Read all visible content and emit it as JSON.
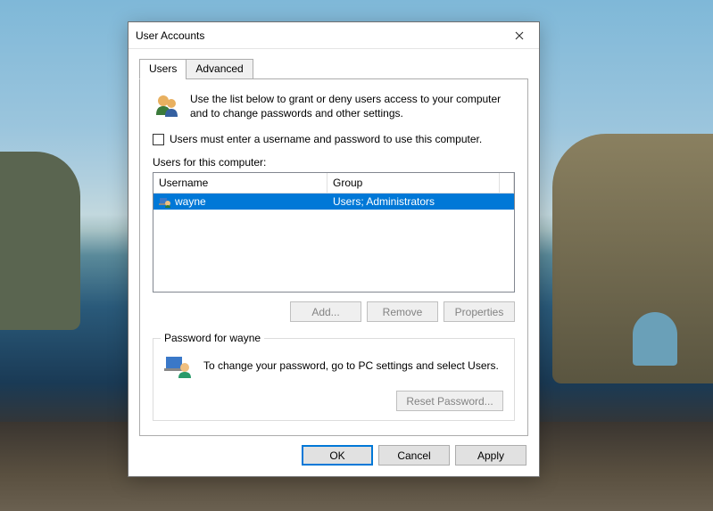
{
  "window": {
    "title": "User Accounts"
  },
  "tabs": {
    "users": "Users",
    "advanced": "Advanced"
  },
  "intro_text": "Use the list below to grant or deny users access to your computer and to change passwords and other settings.",
  "checkbox_label": "Users must enter a username and password to use this computer.",
  "users_label": "Users for this computer:",
  "columns": {
    "username": "Username",
    "group": "Group"
  },
  "rows": [
    {
      "username": "wayne",
      "group": "Users; Administrators"
    }
  ],
  "buttons": {
    "add": "Add...",
    "remove": "Remove",
    "properties": "Properties",
    "reset_pw": "Reset Password...",
    "ok": "OK",
    "cancel": "Cancel",
    "apply": "Apply"
  },
  "password_box": {
    "title": "Password for wayne",
    "text": "To change your password, go to PC settings and select Users."
  }
}
